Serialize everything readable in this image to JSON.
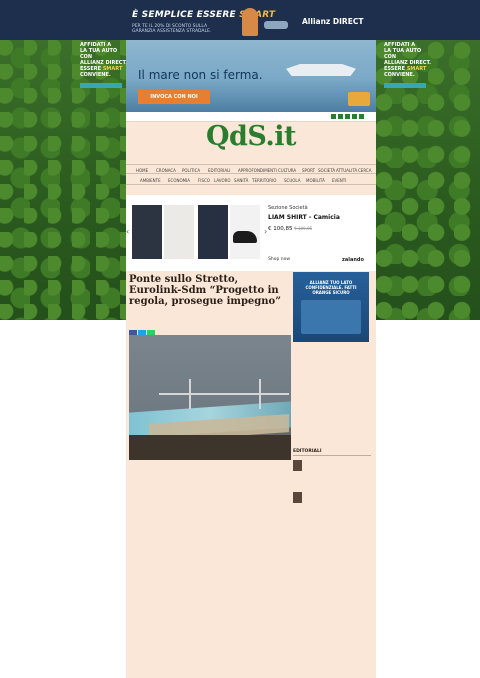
{
  "top_banner": {
    "headline_1": "È SEMPLICE ESSERE ",
    "headline_2": "SMART",
    "sub": "PER TE IL 20% DI SCONTO SULLA GARANZIA ASSISTENZA STRADALE.",
    "brand_1": "Allianz ",
    "brand_2": "DIRECT"
  },
  "side_ad": {
    "line1": "AFFIDATI A",
    "line2": "LA TUA AUTO CON",
    "line3": "ALLIANZ DIRECT.",
    "line4": "ESSERE ",
    "line5": "SMART",
    "line6": "CONVIENE."
  },
  "sea_ad": {
    "text": "Il mare non si ferma.",
    "button": "INVOCA CON NOI"
  },
  "site": {
    "logo_main": "QdS",
    "logo_ext": ".it"
  },
  "nav1": [
    "HOME",
    "CRONACA",
    "POLITICA",
    "EDITORIALI",
    "APPROFONDIMENTI",
    "CULTURA",
    "SPORT",
    "SOCIETÀ",
    "ATTUALITÀ",
    "CERCA"
  ],
  "nav2": [
    "AMBIENTE",
    "ECONOMIA",
    "FISCO",
    "LAVORO",
    "SANITÀ",
    "TERRITORIO",
    "SCUOLA",
    "MOBILITÀ",
    "EVENTI"
  ],
  "product_ad": {
    "store": "Sezione Società",
    "name": "LIAM SHIRT - Camicia",
    "price": "€ 100,85",
    "old": "€ 109,95",
    "shop": "Shop now",
    "zalando": "zalando"
  },
  "article": {
    "title": "Ponte sullo Stretto, Eurolink-Sdm “Progetto in regola, prosegue impegno”"
  },
  "sidebar": {
    "banner": "ALLIANZ TUO LATO CONFIDENZIALE. FATTI ORANGE SICURO",
    "editorial_title": "EDITORIALI"
  }
}
